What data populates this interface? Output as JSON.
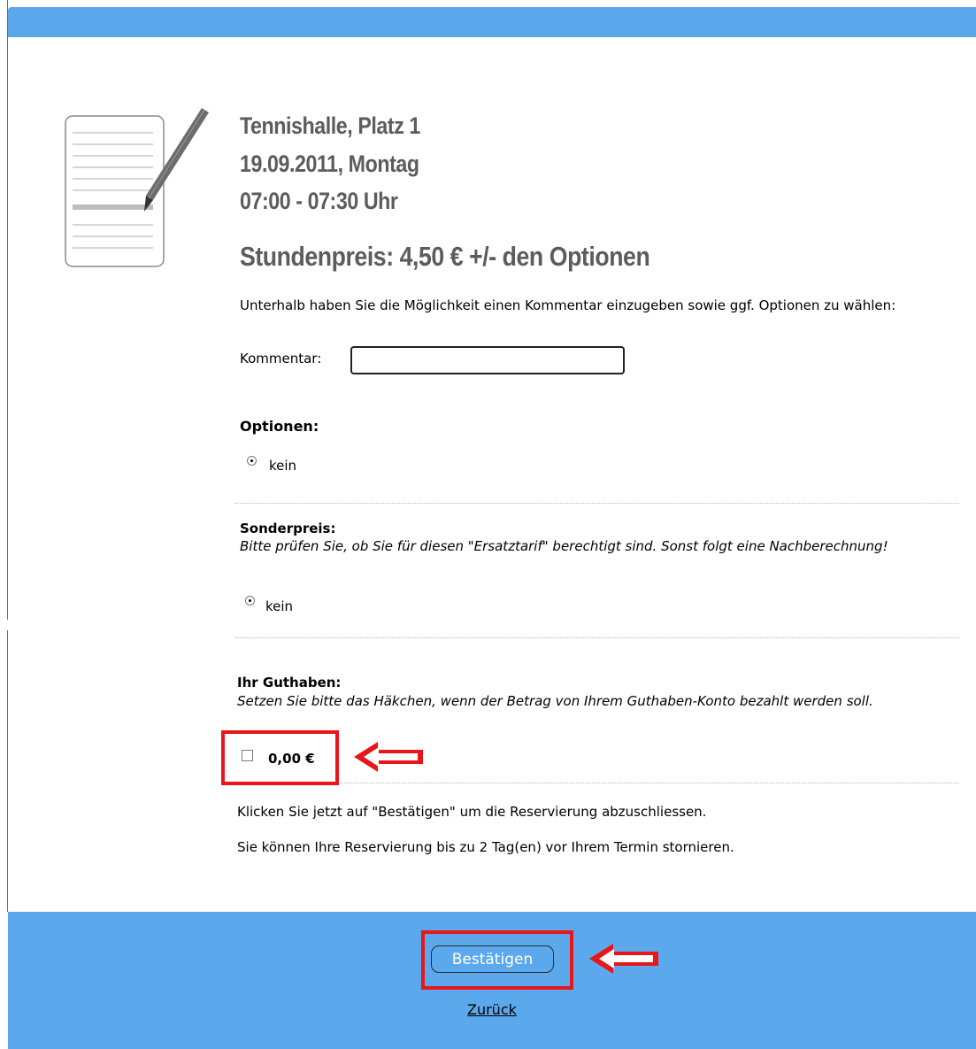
{
  "booking": {
    "court": "Tennishalle, Platz 1",
    "date": "19.09.2011, Montag",
    "time": "07:00 - 07:30 Uhr",
    "price": "Stundenpreis: 4,50 € +/- den Optionen"
  },
  "form": {
    "intro": "Unterhalb haben Sie die Möglichkeit einen Kommentar einzugeben sowie ggf. Optionen zu wählen:",
    "comment_label": "Kommentar:",
    "comment_value": "",
    "options_title": "Optionen:",
    "options_selected": "kein",
    "special_title": "Sonderpreis:",
    "special_note": "Bitte prüfen Sie, ob Sie für diesen \"Ersatztarif\" berechtigt sind. Sonst folgt eine Nachberechnung!",
    "special_selected": "kein",
    "credit_title": "Ihr Guthaben:",
    "credit_note": "Setzen Sie bitte das Häkchen, wenn der Betrag von Ihrem Guthaben-Konto bezahlt werden soll.",
    "credit_amount": "0,00 €",
    "credit_checked": false
  },
  "info": {
    "confirm_hint": "Klicken Sie jetzt auf \"Bestätigen\" um die Reservierung abzuschliessen.",
    "cancel_hint": "Sie können Ihre Reservierung bis zu 2 Tag(en) vor Ihrem Termin stornieren."
  },
  "footer": {
    "confirm_label": "Bestätigen",
    "back_label": "Zurück"
  },
  "colors": {
    "bar": "#5ba8ec",
    "highlight": "#e8161b",
    "heading": "#5c5c5c"
  },
  "icons": [
    "document-pen-icon",
    "annotation-arrow-icon"
  ]
}
